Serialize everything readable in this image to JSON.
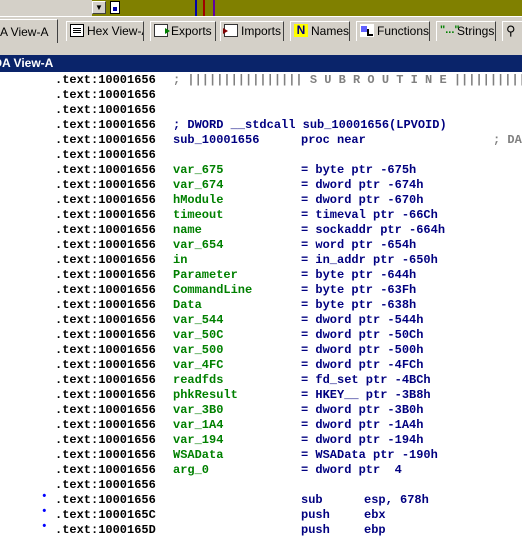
{
  "tabs": [
    {
      "label": "IDA View-A",
      "icon": "ida-view-icon"
    },
    {
      "label": "Hex View-A",
      "icon": "hex-view-icon"
    },
    {
      "label": "Exports",
      "icon": "exports-icon"
    },
    {
      "label": "Imports",
      "icon": "imports-icon"
    },
    {
      "label": "Names",
      "icon": "names-icon"
    },
    {
      "label": "Functions",
      "icon": "functions-icon"
    },
    {
      "label": "Strings",
      "icon": "strings-icon"
    }
  ],
  "window_title": "IDA View-A",
  "header": {
    "subroutine_banner": "; |||||||||||||||| S U B R O U T I N E |||||||||||||||||",
    "prototype_comment": "; DWORD __stdcall sub_10001656(LPVOID)",
    "proc_name": "sub_10001656",
    "proc_keyword": "proc near",
    "proc_tail": "; DA"
  },
  "address": ".text:10001656",
  "stack_vars": [
    {
      "name": "var_675",
      "def": "= byte ptr -675h"
    },
    {
      "name": "var_674",
      "def": "= dword ptr -674h"
    },
    {
      "name": "hModule",
      "def": "= dword ptr -670h"
    },
    {
      "name": "timeout",
      "def": "= timeval ptr -66Ch"
    },
    {
      "name": "name",
      "def": "= sockaddr ptr -664h"
    },
    {
      "name": "var_654",
      "def": "= word ptr -654h"
    },
    {
      "name": "in",
      "def": "= in_addr ptr -650h"
    },
    {
      "name": "Parameter",
      "def": "= byte ptr -644h"
    },
    {
      "name": "CommandLine",
      "def": "= byte ptr -63Fh"
    },
    {
      "name": "Data",
      "def": "= byte ptr -638h"
    },
    {
      "name": "var_544",
      "def": "= dword ptr -544h"
    },
    {
      "name": "var_50C",
      "def": "= dword ptr -50Ch"
    },
    {
      "name": "var_500",
      "def": "= dword ptr -500h"
    },
    {
      "name": "var_4FC",
      "def": "= dword ptr -4FCh"
    },
    {
      "name": "readfds",
      "def": "= fd_set ptr -4BCh"
    },
    {
      "name": "phkResult",
      "def": "= HKEY__ ptr -3B8h"
    },
    {
      "name": "var_3B0",
      "def": "= dword ptr -3B0h"
    },
    {
      "name": "var_1A4",
      "def": "= dword ptr -1A4h"
    },
    {
      "name": "var_194",
      "def": "= dword ptr -194h"
    },
    {
      "name": "WSAData",
      "def": "= WSAData ptr -190h"
    },
    {
      "name": "arg_0",
      "def": "= dword ptr  4"
    }
  ],
  "instructions": [
    {
      "address": ".text:10001656",
      "mnemonic": "sub",
      "operands": "esp, 678h"
    },
    {
      "address": ".text:1000165C",
      "mnemonic": "push",
      "operands": "ebx"
    },
    {
      "address": ".text:1000165D",
      "mnemonic": "push",
      "operands": "ebp"
    }
  ],
  "colors": {
    "title_bar": "#0a246a",
    "tab_bg": "#d4d0c8",
    "var_names": "#000080",
    "definitions": "#000080",
    "comment": "#808080",
    "addresses": "#000000"
  }
}
